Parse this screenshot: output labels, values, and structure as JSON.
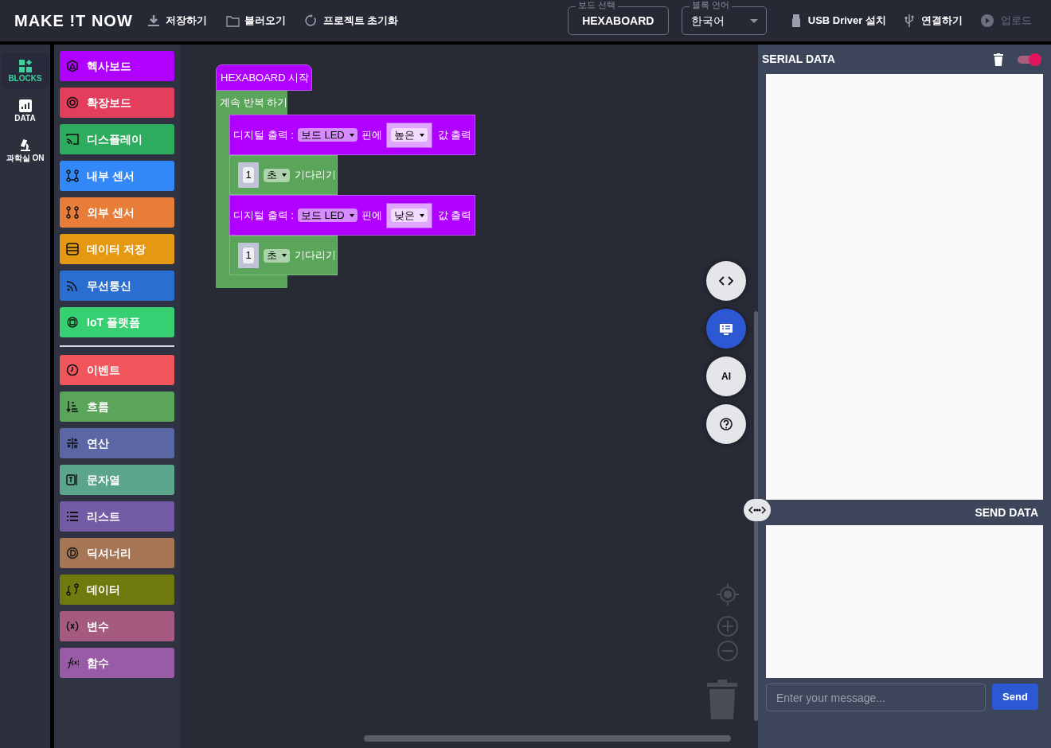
{
  "header": {
    "logo": "MAKE !T NOW",
    "menu": [
      {
        "label": "저장하기"
      },
      {
        "label": "불러오기"
      },
      {
        "label": "프로젝트 초기화"
      }
    ],
    "board_select": {
      "label": "보드 선택",
      "value": "HEXABOARD"
    },
    "language_select": {
      "label": "블록 언어",
      "value": "한국어"
    },
    "actions": [
      {
        "label": "USB Driver 설치",
        "disabled": false
      },
      {
        "label": "연결하기",
        "disabled": false
      },
      {
        "label": "업로드",
        "disabled": true
      }
    ]
  },
  "nav": [
    {
      "label": "BLOCKS",
      "selected": true
    },
    {
      "label": "DATA",
      "selected": false
    },
    {
      "label": "과학실 ON",
      "selected": false
    }
  ],
  "category_groups": [
    [
      {
        "label": "헥사보드",
        "color": "#b000ff"
      },
      {
        "label": "확장보드",
        "color": "#e33e5c"
      },
      {
        "label": "디스플레이",
        "color": "#2eac5e"
      },
      {
        "label": "내부 센서",
        "color": "#3388f7"
      },
      {
        "label": "외부 센서",
        "color": "#e77d39"
      },
      {
        "label": "데이터 저장",
        "color": "#e59812"
      },
      {
        "label": "무선통신",
        "color": "#2a6ed2"
      },
      {
        "label": "IoT 플랫폼",
        "color": "#36cf72"
      }
    ],
    [
      {
        "label": "이벤트",
        "color": "#f1565c"
      },
      {
        "label": "흐름",
        "color": "#5ba55b"
      },
      {
        "label": "연산",
        "color": "#5b67a5"
      },
      {
        "label": "문자열",
        "color": "#5ba58c"
      },
      {
        "label": "리스트",
        "color": "#745ba5"
      },
      {
        "label": "딕셔너리",
        "color": "#a57554"
      },
      {
        "label": "데이터",
        "color": "#6e7a0e"
      },
      {
        "label": "변수",
        "color": "#a55b80"
      },
      {
        "label": "함수",
        "color": "#995ba5"
      }
    ]
  ],
  "program": {
    "start": "HEXABOARD 시작",
    "loop": "계속 반복 하기",
    "statements": [
      {
        "kind": "digital_write",
        "label": "디지털 출력 :",
        "pin": "보드 LED",
        "pin_suffix": "핀에",
        "value": "높은",
        "suffix": "값 출력"
      },
      {
        "kind": "wait",
        "number": "1",
        "unit": "초",
        "suffix": "기다리기"
      },
      {
        "kind": "digital_write",
        "label": "디지털 출력 :",
        "pin": "보드 LED",
        "pin_suffix": "핀에",
        "value": "낮은",
        "suffix": "값 출력"
      },
      {
        "kind": "wait",
        "number": "1",
        "unit": "초",
        "suffix": "기다리기"
      }
    ]
  },
  "float_buttons": [
    {
      "kind": "code",
      "selected": false
    },
    {
      "kind": "monitor",
      "selected": true
    },
    {
      "kind": "ai",
      "label": "AI",
      "selected": false
    },
    {
      "kind": "help",
      "selected": false
    }
  ],
  "serial": {
    "title": "SERIAL DATA",
    "toggle_on": true,
    "send_title": "SEND DATA",
    "placeholder": "Enter your message...",
    "send_button": "Send"
  }
}
